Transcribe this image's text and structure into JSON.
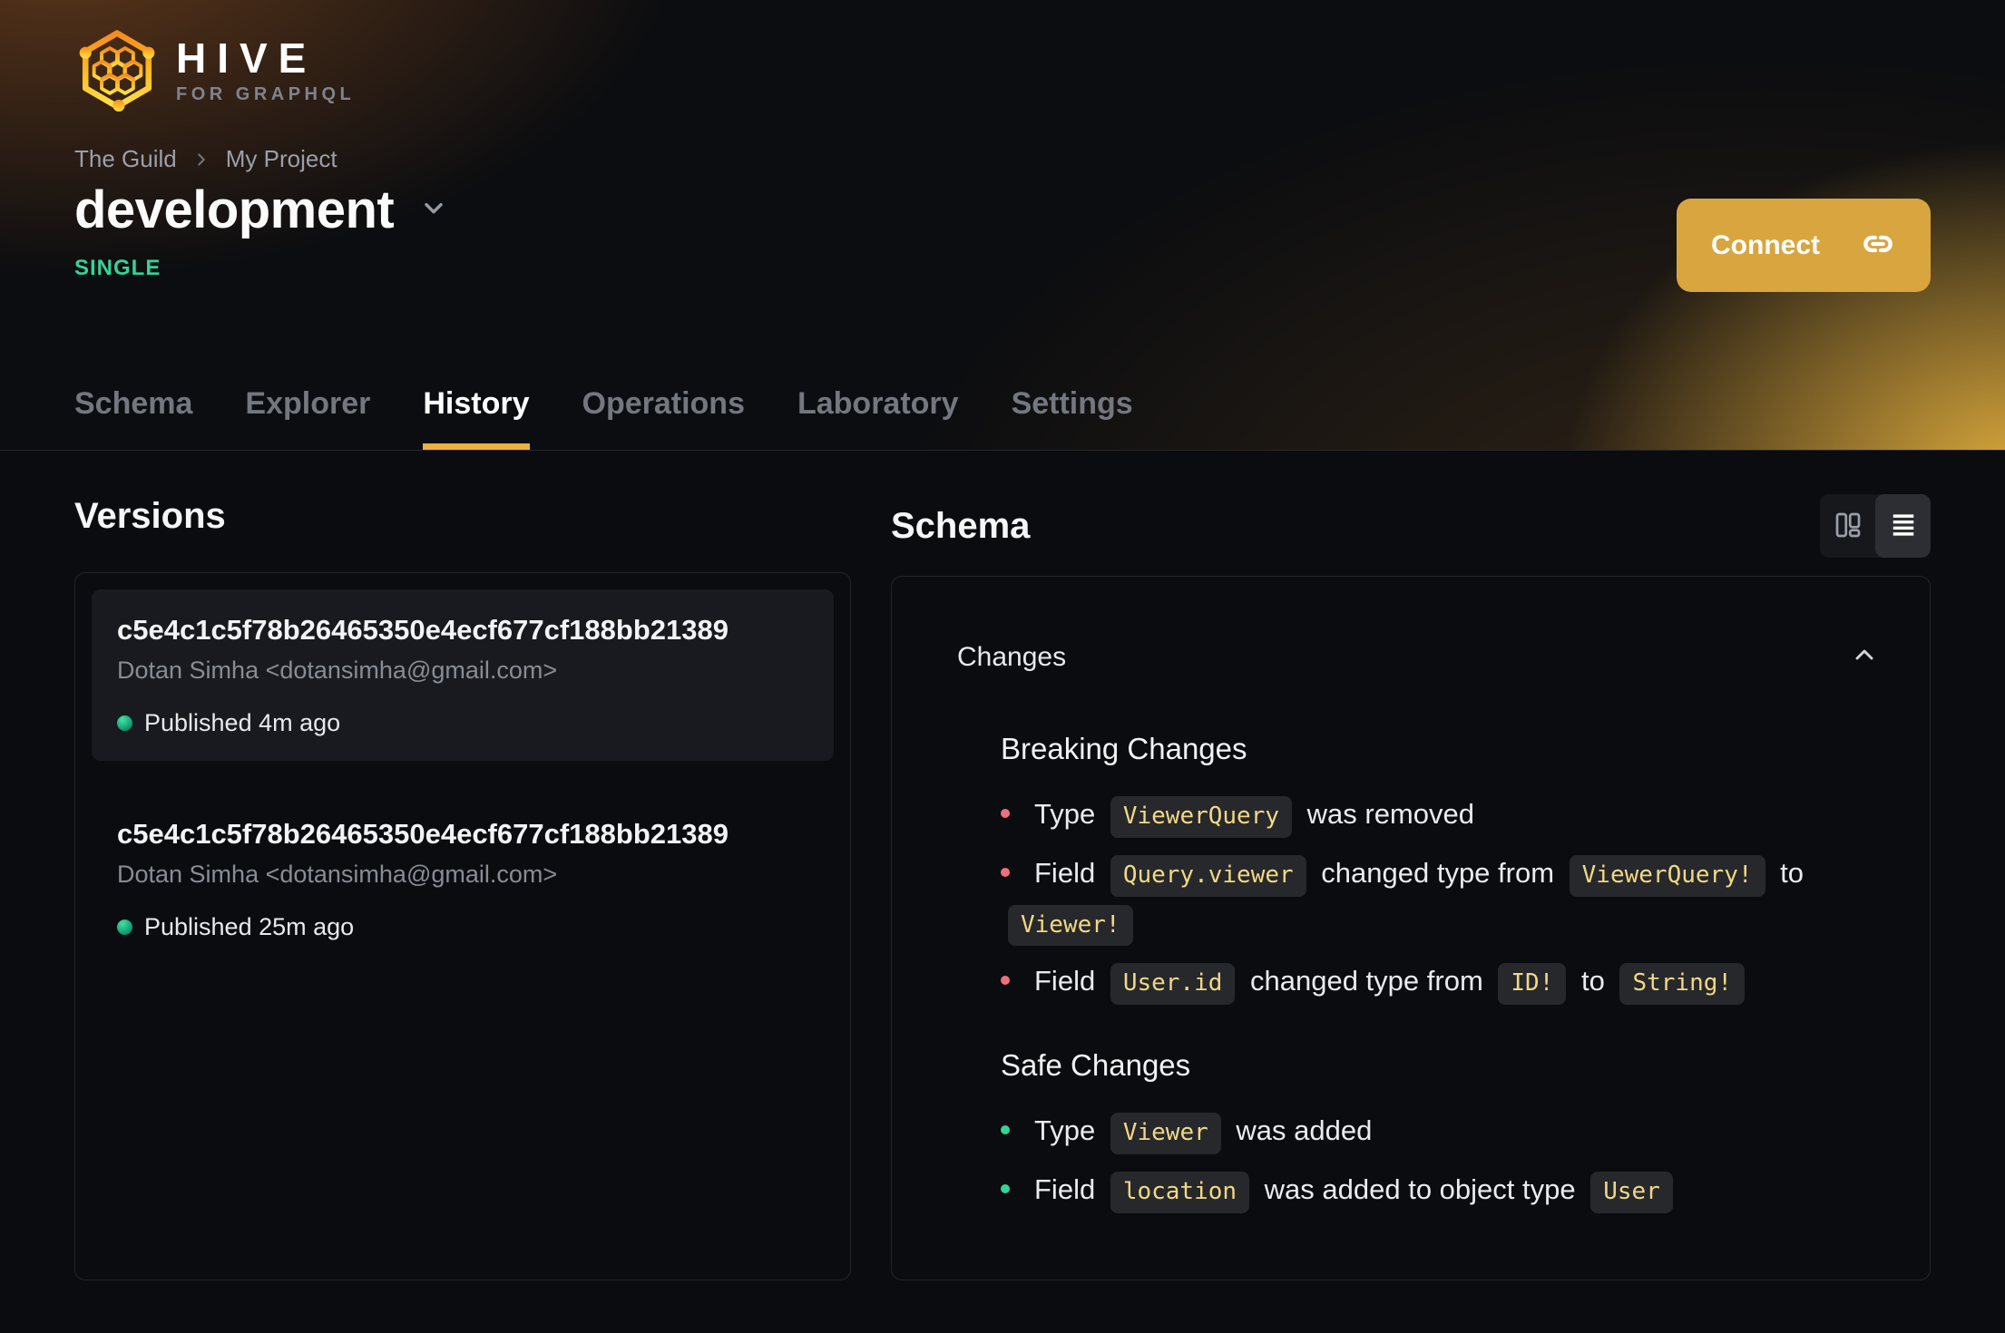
{
  "brand": {
    "name": "HIVE",
    "tagline": "FOR GRAPHQL"
  },
  "breadcrumb": {
    "items": [
      "The Guild",
      "My Project"
    ]
  },
  "target": {
    "name": "development",
    "badge": "SINGLE"
  },
  "actions": {
    "connect_label": "Connect",
    "connect_icon": "link-icon"
  },
  "tabs": [
    {
      "label": "Schema",
      "active": false
    },
    {
      "label": "Explorer",
      "active": false
    },
    {
      "label": "History",
      "active": true
    },
    {
      "label": "Operations",
      "active": false
    },
    {
      "label": "Laboratory",
      "active": false
    },
    {
      "label": "Settings",
      "active": false
    }
  ],
  "versions": {
    "title": "Versions",
    "items": [
      {
        "hash": "c5e4c1c5f78b26465350e4ecf677cf188bb21389",
        "author": "Dotan Simha <dotansimha@gmail.com>",
        "status": "Published 4m ago",
        "highlighted": true
      },
      {
        "hash": "c5e4c1c5f78b26465350e4ecf677cf188bb21389",
        "author": "Dotan Simha <dotansimha@gmail.com>",
        "status": "Published 25m ago",
        "highlighted": false
      }
    ]
  },
  "schema": {
    "title": "Schema",
    "view_toggle": {
      "options": [
        "columns-view-icon",
        "list-view-icon"
      ],
      "active": "list-view-icon"
    },
    "changes": {
      "header": "Changes",
      "collapse_icon": "chevron-up-icon",
      "sections": [
        {
          "title": "Breaking Changes",
          "kind": "breaking",
          "items": [
            [
              {
                "t": "text",
                "v": "Type"
              },
              {
                "t": "code",
                "v": "ViewerQuery"
              },
              {
                "t": "text",
                "v": "was removed"
              }
            ],
            [
              {
                "t": "text",
                "v": "Field"
              },
              {
                "t": "code",
                "v": "Query.viewer"
              },
              {
                "t": "text",
                "v": "changed type from"
              },
              {
                "t": "code",
                "v": "ViewerQuery!"
              },
              {
                "t": "text",
                "v": "to"
              },
              {
                "t": "code",
                "v": "Viewer!"
              }
            ],
            [
              {
                "t": "text",
                "v": "Field"
              },
              {
                "t": "code",
                "v": "User.id"
              },
              {
                "t": "text",
                "v": "changed type from"
              },
              {
                "t": "code",
                "v": "ID!"
              },
              {
                "t": "text",
                "v": "to"
              },
              {
                "t": "code",
                "v": "String!"
              }
            ]
          ]
        },
        {
          "title": "Safe Changes",
          "kind": "safe",
          "items": [
            [
              {
                "t": "text",
                "v": "Type"
              },
              {
                "t": "code",
                "v": "Viewer"
              },
              {
                "t": "text",
                "v": "was added"
              }
            ],
            [
              {
                "t": "text",
                "v": "Field"
              },
              {
                "t": "code",
                "v": "location"
              },
              {
                "t": "text",
                "v": "was added to object type"
              },
              {
                "t": "code",
                "v": "User"
              }
            ]
          ]
        }
      ]
    }
  },
  "colors": {
    "accent_underline": "#efb13e",
    "connect_button": "#d9a53e",
    "badge": "#34d399",
    "breaking_bullet": "#ed717d",
    "safe_bullet": "#34d399",
    "chip_text": "#f3d883"
  }
}
